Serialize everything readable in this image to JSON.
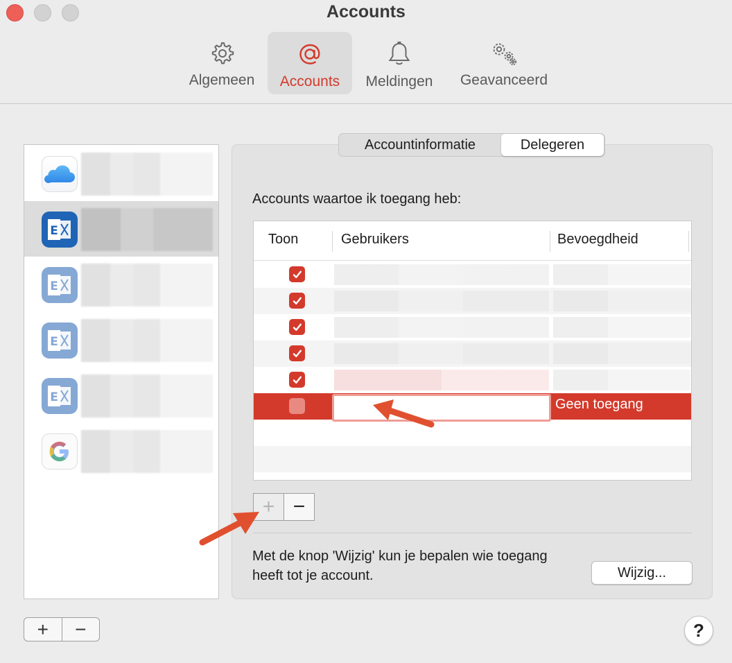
{
  "window": {
    "title": "Accounts",
    "colors": {
      "accent": "#d33a2c",
      "close": "#ee5f57"
    }
  },
  "toolbar": {
    "items": [
      {
        "label": "Algemeen",
        "icon": "gear-icon"
      },
      {
        "label": "Accounts",
        "icon": "at-sign-icon",
        "active": true
      },
      {
        "label": "Meldingen",
        "icon": "bell-icon"
      },
      {
        "label": "Geavanceerd",
        "icon": "gears-icon"
      }
    ]
  },
  "sidebar": {
    "accounts": [
      {
        "icon": "icloud-icon"
      },
      {
        "icon": "exchange-icon",
        "selected": true
      },
      {
        "icon": "exchange-icon"
      },
      {
        "icon": "exchange-icon"
      },
      {
        "icon": "exchange-icon"
      },
      {
        "icon": "google-icon"
      }
    ],
    "add_label": "+",
    "remove_label": "−"
  },
  "tabs": {
    "items": [
      "Accountinformatie",
      "Delegeren"
    ],
    "selected": "Delegeren"
  },
  "delegates": {
    "heading": "Accounts waartoe ik toegang heb:",
    "columns": [
      "Toon",
      "Gebruikers",
      "Bevoegdheid"
    ],
    "rows": [
      {
        "show": true
      },
      {
        "show": true
      },
      {
        "show": true
      },
      {
        "show": true
      },
      {
        "show": true
      },
      {
        "show": false,
        "permission": "Geen toegang",
        "selected": true
      }
    ],
    "add_label": "+",
    "remove_label": "−"
  },
  "footer": {
    "info": "Met de knop 'Wijzig' kun je bepalen wie toegang heeft tot je account.",
    "edit_button": "Wijzig...",
    "help_label": "?"
  }
}
